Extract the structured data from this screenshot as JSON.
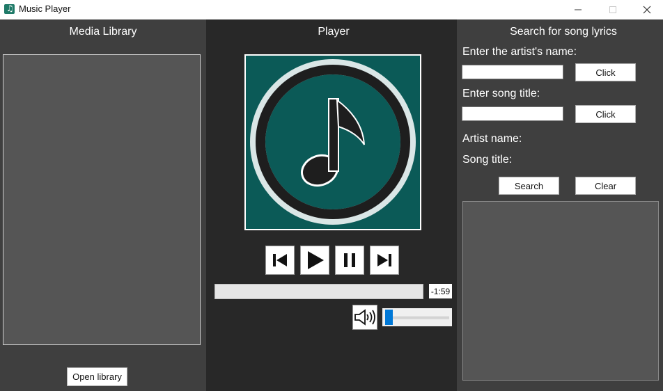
{
  "window": {
    "title": "Music Player",
    "icon": "music-note-icon"
  },
  "library": {
    "heading": "Media Library",
    "items": [],
    "open_button": "Open library"
  },
  "player": {
    "heading": "Player",
    "album_art_icon": "music-note-icon",
    "controls": [
      "previous-icon",
      "play-icon",
      "pause-icon",
      "next-icon"
    ],
    "progress": 0,
    "time_remaining": "-1:59",
    "volume_icon": "speaker-icon",
    "volume_level": 0.05
  },
  "lyrics": {
    "heading": "Search for song lyrics",
    "artist_prompt": "Enter the artist's name:",
    "artist_value": "",
    "artist_click": "Click",
    "title_prompt": "Enter song title:",
    "title_value": "",
    "title_click": "Click",
    "artist_name_label": "Artist name:",
    "song_title_label": "Song title:",
    "search_button": "Search",
    "clear_button": "Clear",
    "results_text": ""
  },
  "colors": {
    "panel_side": "#3f3f3f",
    "panel_center": "#282828",
    "album_bg": "#0b5a57",
    "accent": "#0078d7"
  }
}
